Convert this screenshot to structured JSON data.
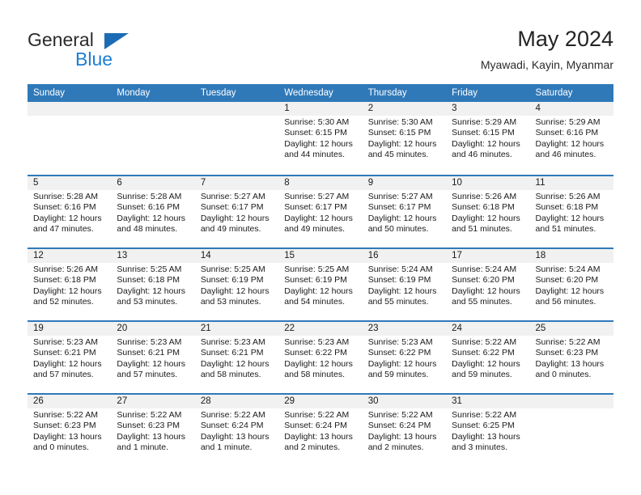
{
  "brand": {
    "name_part1": "General",
    "name_part2": "Blue",
    "triangle_color": "#1b6cb4",
    "blue_color": "#1b7fd4"
  },
  "header": {
    "title": "May 2024",
    "subtitle": "Myawadi, Kayin, Myanmar"
  },
  "theme": {
    "header_blue": "#3079b9",
    "day_band_gray": "#f1f1f1"
  },
  "calendar": {
    "weekdays": [
      "Sunday",
      "Monday",
      "Tuesday",
      "Wednesday",
      "Thursday",
      "Friday",
      "Saturday"
    ],
    "weeks": [
      [
        {
          "day": "",
          "empty": true
        },
        {
          "day": "",
          "empty": true
        },
        {
          "day": "",
          "empty": true
        },
        {
          "day": "1",
          "sunrise": "Sunrise: 5:30 AM",
          "sunset": "Sunset: 6:15 PM",
          "daylight_line1": "Daylight: 12 hours",
          "daylight_line2": "and 44 minutes."
        },
        {
          "day": "2",
          "sunrise": "Sunrise: 5:30 AM",
          "sunset": "Sunset: 6:15 PM",
          "daylight_line1": "Daylight: 12 hours",
          "daylight_line2": "and 45 minutes."
        },
        {
          "day": "3",
          "sunrise": "Sunrise: 5:29 AM",
          "sunset": "Sunset: 6:15 PM",
          "daylight_line1": "Daylight: 12 hours",
          "daylight_line2": "and 46 minutes."
        },
        {
          "day": "4",
          "sunrise": "Sunrise: 5:29 AM",
          "sunset": "Sunset: 6:16 PM",
          "daylight_line1": "Daylight: 12 hours",
          "daylight_line2": "and 46 minutes."
        }
      ],
      [
        {
          "day": "5",
          "sunrise": "Sunrise: 5:28 AM",
          "sunset": "Sunset: 6:16 PM",
          "daylight_line1": "Daylight: 12 hours",
          "daylight_line2": "and 47 minutes."
        },
        {
          "day": "6",
          "sunrise": "Sunrise: 5:28 AM",
          "sunset": "Sunset: 6:16 PM",
          "daylight_line1": "Daylight: 12 hours",
          "daylight_line2": "and 48 minutes."
        },
        {
          "day": "7",
          "sunrise": "Sunrise: 5:27 AM",
          "sunset": "Sunset: 6:17 PM",
          "daylight_line1": "Daylight: 12 hours",
          "daylight_line2": "and 49 minutes."
        },
        {
          "day": "8",
          "sunrise": "Sunrise: 5:27 AM",
          "sunset": "Sunset: 6:17 PM",
          "daylight_line1": "Daylight: 12 hours",
          "daylight_line2": "and 49 minutes."
        },
        {
          "day": "9",
          "sunrise": "Sunrise: 5:27 AM",
          "sunset": "Sunset: 6:17 PM",
          "daylight_line1": "Daylight: 12 hours",
          "daylight_line2": "and 50 minutes."
        },
        {
          "day": "10",
          "sunrise": "Sunrise: 5:26 AM",
          "sunset": "Sunset: 6:18 PM",
          "daylight_line1": "Daylight: 12 hours",
          "daylight_line2": "and 51 minutes."
        },
        {
          "day": "11",
          "sunrise": "Sunrise: 5:26 AM",
          "sunset": "Sunset: 6:18 PM",
          "daylight_line1": "Daylight: 12 hours",
          "daylight_line2": "and 51 minutes."
        }
      ],
      [
        {
          "day": "12",
          "sunrise": "Sunrise: 5:26 AM",
          "sunset": "Sunset: 6:18 PM",
          "daylight_line1": "Daylight: 12 hours",
          "daylight_line2": "and 52 minutes."
        },
        {
          "day": "13",
          "sunrise": "Sunrise: 5:25 AM",
          "sunset": "Sunset: 6:18 PM",
          "daylight_line1": "Daylight: 12 hours",
          "daylight_line2": "and 53 minutes."
        },
        {
          "day": "14",
          "sunrise": "Sunrise: 5:25 AM",
          "sunset": "Sunset: 6:19 PM",
          "daylight_line1": "Daylight: 12 hours",
          "daylight_line2": "and 53 minutes."
        },
        {
          "day": "15",
          "sunrise": "Sunrise: 5:25 AM",
          "sunset": "Sunset: 6:19 PM",
          "daylight_line1": "Daylight: 12 hours",
          "daylight_line2": "and 54 minutes."
        },
        {
          "day": "16",
          "sunrise": "Sunrise: 5:24 AM",
          "sunset": "Sunset: 6:19 PM",
          "daylight_line1": "Daylight: 12 hours",
          "daylight_line2": "and 55 minutes."
        },
        {
          "day": "17",
          "sunrise": "Sunrise: 5:24 AM",
          "sunset": "Sunset: 6:20 PM",
          "daylight_line1": "Daylight: 12 hours",
          "daylight_line2": "and 55 minutes."
        },
        {
          "day": "18",
          "sunrise": "Sunrise: 5:24 AM",
          "sunset": "Sunset: 6:20 PM",
          "daylight_line1": "Daylight: 12 hours",
          "daylight_line2": "and 56 minutes."
        }
      ],
      [
        {
          "day": "19",
          "sunrise": "Sunrise: 5:23 AM",
          "sunset": "Sunset: 6:21 PM",
          "daylight_line1": "Daylight: 12 hours",
          "daylight_line2": "and 57 minutes."
        },
        {
          "day": "20",
          "sunrise": "Sunrise: 5:23 AM",
          "sunset": "Sunset: 6:21 PM",
          "daylight_line1": "Daylight: 12 hours",
          "daylight_line2": "and 57 minutes."
        },
        {
          "day": "21",
          "sunrise": "Sunrise: 5:23 AM",
          "sunset": "Sunset: 6:21 PM",
          "daylight_line1": "Daylight: 12 hours",
          "daylight_line2": "and 58 minutes."
        },
        {
          "day": "22",
          "sunrise": "Sunrise: 5:23 AM",
          "sunset": "Sunset: 6:22 PM",
          "daylight_line1": "Daylight: 12 hours",
          "daylight_line2": "and 58 minutes."
        },
        {
          "day": "23",
          "sunrise": "Sunrise: 5:23 AM",
          "sunset": "Sunset: 6:22 PM",
          "daylight_line1": "Daylight: 12 hours",
          "daylight_line2": "and 59 minutes."
        },
        {
          "day": "24",
          "sunrise": "Sunrise: 5:22 AM",
          "sunset": "Sunset: 6:22 PM",
          "daylight_line1": "Daylight: 12 hours",
          "daylight_line2": "and 59 minutes."
        },
        {
          "day": "25",
          "sunrise": "Sunrise: 5:22 AM",
          "sunset": "Sunset: 6:23 PM",
          "daylight_line1": "Daylight: 13 hours",
          "daylight_line2": "and 0 minutes."
        }
      ],
      [
        {
          "day": "26",
          "sunrise": "Sunrise: 5:22 AM",
          "sunset": "Sunset: 6:23 PM",
          "daylight_line1": "Daylight: 13 hours",
          "daylight_line2": "and 0 minutes."
        },
        {
          "day": "27",
          "sunrise": "Sunrise: 5:22 AM",
          "sunset": "Sunset: 6:23 PM",
          "daylight_line1": "Daylight: 13 hours",
          "daylight_line2": "and 1 minute."
        },
        {
          "day": "28",
          "sunrise": "Sunrise: 5:22 AM",
          "sunset": "Sunset: 6:24 PM",
          "daylight_line1": "Daylight: 13 hours",
          "daylight_line2": "and 1 minute."
        },
        {
          "day": "29",
          "sunrise": "Sunrise: 5:22 AM",
          "sunset": "Sunset: 6:24 PM",
          "daylight_line1": "Daylight: 13 hours",
          "daylight_line2": "and 2 minutes."
        },
        {
          "day": "30",
          "sunrise": "Sunrise: 5:22 AM",
          "sunset": "Sunset: 6:24 PM",
          "daylight_line1": "Daylight: 13 hours",
          "daylight_line2": "and 2 minutes."
        },
        {
          "day": "31",
          "sunrise": "Sunrise: 5:22 AM",
          "sunset": "Sunset: 6:25 PM",
          "daylight_line1": "Daylight: 13 hours",
          "daylight_line2": "and 3 minutes."
        },
        {
          "day": "",
          "empty": true
        }
      ]
    ]
  }
}
